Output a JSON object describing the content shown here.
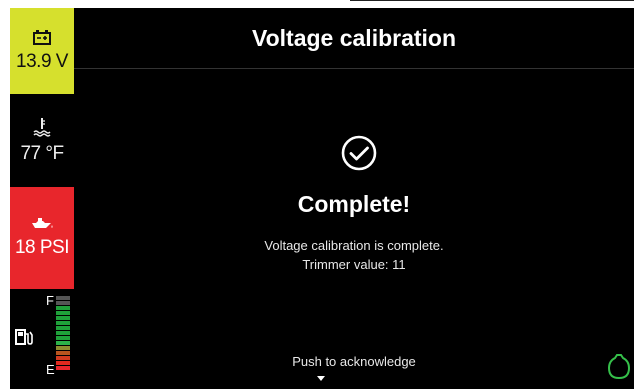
{
  "sidebar": {
    "battery": {
      "icon": "battery-icon",
      "value": "13.9 V"
    },
    "coolant": {
      "icon": "coolant-temp-icon",
      "value": "77 °F"
    },
    "oil": {
      "icon": "oil-pressure-icon",
      "value": "18 PSI"
    },
    "fuel": {
      "icon": "fuel-pump-icon",
      "full_label": "F",
      "empty_label": "E",
      "bar_colors": [
        "#555555",
        "#555555",
        "#1fa03a",
        "#1fa03a",
        "#1fa03a",
        "#1fa03a",
        "#1fa03a",
        "#1fa03a",
        "#1fa03a",
        "#2cb24a",
        "#8d8d30",
        "#b8541f",
        "#d23a1f",
        "#e02a1f",
        "#e8262c"
      ]
    }
  },
  "dialog": {
    "title": "Voltage calibration",
    "status_icon": "check-circle-icon",
    "heading": "Complete!",
    "message_line1": "Voltage calibration is complete.",
    "message_line2": "Trimmer value: 11",
    "acknowledge_label": "Push to acknowledge",
    "acknowledge_icon": "caret-down-icon",
    "power_icon": "power-icon"
  },
  "colors": {
    "battery_tile": "#d6e02d",
    "oil_tile": "#e8262c",
    "power_icon": "#35c04a"
  }
}
